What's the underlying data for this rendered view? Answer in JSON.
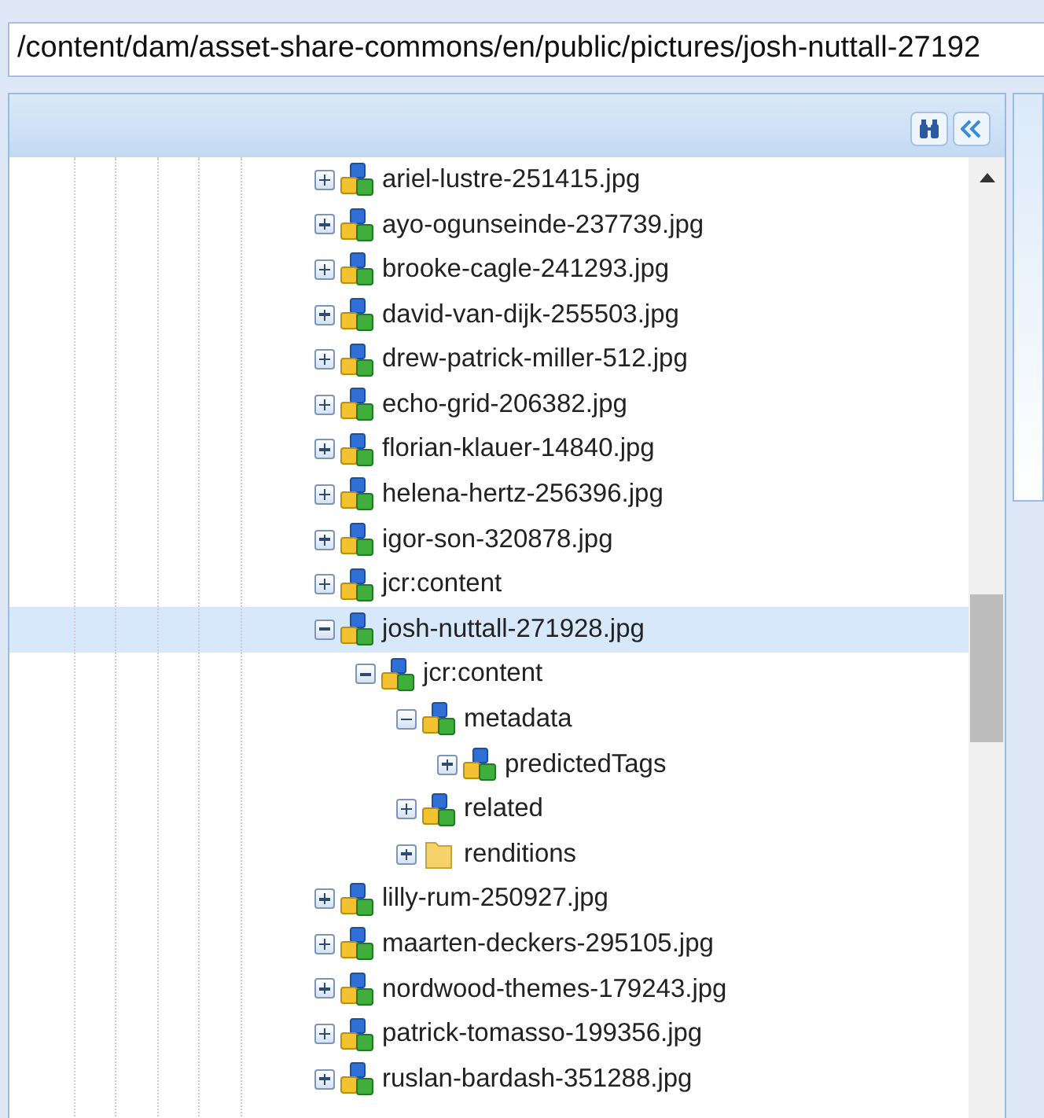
{
  "path_field": {
    "value": "/content/dam/asset-share-commons/en/public/pictures/josh-nuttall-27192"
  },
  "tree": [
    {
      "label": "ariel-lustre-251415.jpg",
      "kind": "node",
      "expanded": false,
      "selected": false
    },
    {
      "label": "ayo-ogunseinde-237739.jpg",
      "kind": "node",
      "expanded": false,
      "selected": false
    },
    {
      "label": "brooke-cagle-241293.jpg",
      "kind": "node",
      "expanded": false,
      "selected": false
    },
    {
      "label": "david-van-dijk-255503.jpg",
      "kind": "node",
      "expanded": false,
      "selected": false
    },
    {
      "label": "drew-patrick-miller-512.jpg",
      "kind": "node",
      "expanded": false,
      "selected": false
    },
    {
      "label": "echo-grid-206382.jpg",
      "kind": "node",
      "expanded": false,
      "selected": false
    },
    {
      "label": "florian-klauer-14840.jpg",
      "kind": "node",
      "expanded": false,
      "selected": false
    },
    {
      "label": "helena-hertz-256396.jpg",
      "kind": "node",
      "expanded": false,
      "selected": false
    },
    {
      "label": "igor-son-320878.jpg",
      "kind": "node",
      "expanded": false,
      "selected": false
    },
    {
      "label": "jcr:content",
      "kind": "node",
      "expanded": false,
      "selected": false
    },
    {
      "label": "josh-nuttall-271928.jpg",
      "kind": "node",
      "expanded": true,
      "selected": true,
      "children": [
        {
          "label": "jcr:content",
          "kind": "node",
          "expanded": true,
          "selected": false,
          "children": [
            {
              "label": "metadata",
              "kind": "node",
              "expanded": true,
              "selected": false,
              "children": [
                {
                  "label": "predictedTags",
                  "kind": "node",
                  "expanded": false,
                  "selected": false
                }
              ]
            },
            {
              "label": "related",
              "kind": "node",
              "expanded": false,
              "selected": false
            },
            {
              "label": "renditions",
              "kind": "folder",
              "expanded": false,
              "selected": false
            }
          ]
        }
      ]
    },
    {
      "label": "lilly-rum-250927.jpg",
      "kind": "node",
      "expanded": false,
      "selected": false
    },
    {
      "label": "maarten-deckers-295105.jpg",
      "kind": "node",
      "expanded": false,
      "selected": false
    },
    {
      "label": "nordwood-themes-179243.jpg",
      "kind": "node",
      "expanded": false,
      "selected": false
    },
    {
      "label": "patrick-tomasso-199356.jpg",
      "kind": "node",
      "expanded": false,
      "selected": false
    },
    {
      "label": "ruslan-bardash-351288.jpg",
      "kind": "node",
      "expanded": false,
      "selected": false
    }
  ]
}
